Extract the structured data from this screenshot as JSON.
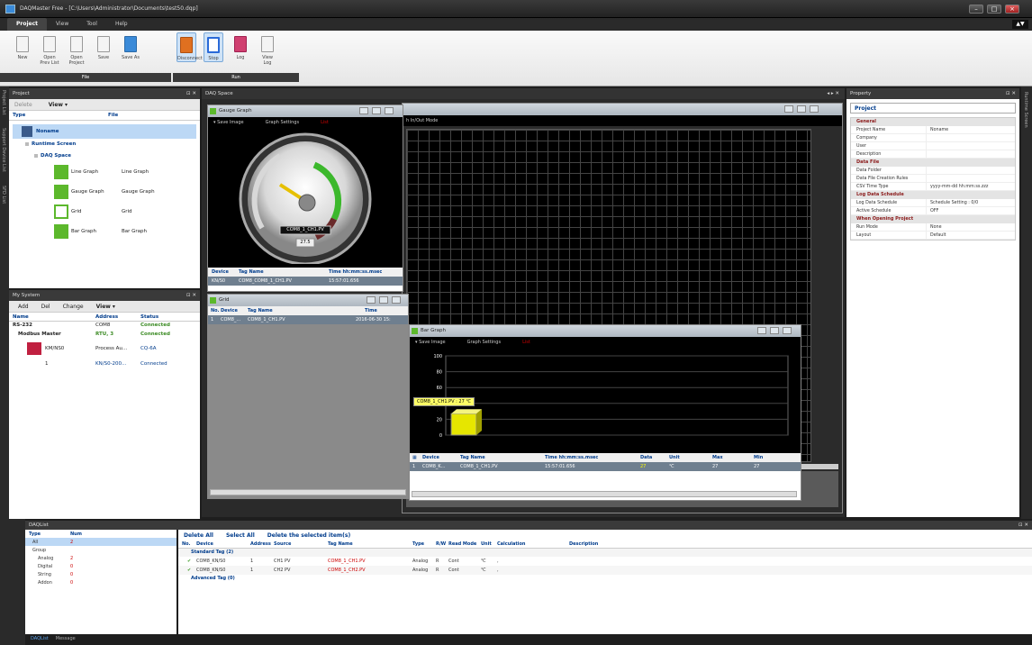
{
  "app": {
    "title": "DAQMaster Free - [C:\\Users\\Administrator\\Documents\\test50.dqp]"
  },
  "menu": [
    "Project",
    "View",
    "Tool",
    "Help"
  ],
  "ribbon": {
    "file_buttons": [
      "New",
      "Open Prev List",
      "Open Project",
      "Save",
      "Save As"
    ],
    "run_buttons": [
      "Disconnect",
      "Stop",
      "Log",
      "View Log"
    ],
    "file_group": "File",
    "run_group": "Run"
  },
  "project_panel": {
    "title": "Project",
    "toolbar": {
      "delete": "Delete",
      "view": "View ▾"
    },
    "columns": [
      "Type",
      "File"
    ],
    "root": "Noname",
    "runtime": "Runtime Screen",
    "daq_space": "DAQ Space",
    "items": [
      {
        "type": "Line Graph",
        "file": "Line Graph"
      },
      {
        "type": "Gauge Graph",
        "file": "Gauge Graph"
      },
      {
        "type": "Grid",
        "file": "Grid"
      },
      {
        "type": "Bar Graph",
        "file": "Bar Graph"
      }
    ]
  },
  "left_tabs": [
    "Project List",
    "Support Device List",
    "SFD List"
  ],
  "right_tabs": [
    "Runtime Screen"
  ],
  "mysystem": {
    "title": "My System",
    "toolbar": {
      "add": "Add",
      "del": "Del",
      "change": "Change",
      "view": "View ▾"
    },
    "columns": [
      "Name",
      "Address",
      "Status"
    ],
    "rows": [
      {
        "name": "RS-232",
        "address": "COM8",
        "status": "Connected"
      },
      {
        "name": "Modbus Master",
        "address": "RTU, 3",
        "status": "Connected"
      },
      {
        "name": "KM/NS0",
        "address": "Process Au...",
        "status": "CQ-6A"
      },
      {
        "name": "1",
        "address": "KN/S0-200...",
        "status": "Connected"
      }
    ]
  },
  "daq_space": {
    "title": "DAQ Space",
    "line_mode_label": "h In/Out Mode"
  },
  "gauge_window": {
    "title": "Gauge Graph",
    "toolbar": {
      "save": "▾ Save Image",
      "settings": "Graph Settings",
      "list": "List"
    },
    "tag_label": "COM8_1_CH1.PV",
    "value": "27.5",
    "columns": [
      "Device",
      "Tag Name",
      "Time hh:mm:ss.msec"
    ],
    "row": [
      "KN/S0",
      "COM8_COM8_1_CH1.PV",
      "15:57:01.656"
    ]
  },
  "grid_window": {
    "title": "Grid",
    "columns": [
      "No.",
      "Device",
      "Tag Name",
      "Time"
    ],
    "row": [
      "1",
      "COM8_...",
      "COM8_1_CH1.PV",
      "2016-06-30 15:"
    ]
  },
  "bar_window": {
    "title": "Bar Graph",
    "toolbar": {
      "save": "▾ Save Image",
      "settings": "Graph Settings",
      "list": "List"
    },
    "tooltip": "COM8_1_CH1.PV : 27 ℃",
    "columns": [
      "",
      "Device",
      "Tag Name",
      "Time hh:mm:ss.msec",
      "Data",
      "Unit",
      "Max",
      "Min"
    ],
    "row": [
      "1",
      "COM8_K...",
      "COM8_1_CH1.PV",
      "15:57:01.656",
      "27",
      "℃",
      "27",
      "27"
    ]
  },
  "chart_data": {
    "type": "bar",
    "categories": [
      "COM8_1_CH1.PV"
    ],
    "values": [
      27
    ],
    "ylim": [
      0,
      100
    ],
    "yticks": [
      "100",
      "80",
      "60",
      "40",
      "20",
      "0"
    ]
  },
  "property_panel": {
    "title": "Property",
    "header": "Project",
    "categories": [
      {
        "name": "General",
        "rows": [
          [
            "Project Name",
            "Noname"
          ],
          [
            "Company",
            ""
          ],
          [
            "User",
            ""
          ],
          [
            "Description",
            ""
          ]
        ]
      },
      {
        "name": "Data File",
        "rows": [
          [
            "Data Folder",
            ""
          ],
          [
            "Data File Creation Rules",
            ""
          ],
          [
            "CSV Time Type",
            "yyyy-mm-dd hh:mm:ss.zzz"
          ]
        ]
      },
      {
        "name": "Log Data Schedule",
        "rows": [
          [
            "Log Data Schedule",
            "Schedule Setting : 0/0"
          ],
          [
            "Active Schedule",
            "OFF"
          ]
        ]
      },
      {
        "name": "When Opening Project",
        "rows": [
          [
            "Run Mode",
            "None"
          ],
          [
            "Layout",
            "Default"
          ]
        ]
      }
    ]
  },
  "daqlist": {
    "title": "DAQList",
    "left_columns": [
      "Type",
      "Num"
    ],
    "left_rows": [
      {
        "type": "All",
        "num": "2",
        "selected": true
      },
      {
        "type": "Group",
        "num": ""
      },
      {
        "type": "Analog",
        "num": "2"
      },
      {
        "type": "Digital",
        "num": "0"
      },
      {
        "type": "String",
        "num": "0"
      },
      {
        "type": "Addon",
        "num": "0"
      }
    ],
    "toolbar": [
      "Delete All",
      "Select All",
      "Delete the selected item(s)"
    ],
    "columns": [
      "No.",
      "Device",
      "Address",
      "Source",
      "Tag Name",
      "Type",
      "R/W",
      "Read Mode",
      "Unit",
      "Calculation",
      "Description"
    ],
    "group_standard": "Standard Tag (2)",
    "rows": [
      [
        "",
        "COM8_KN/S0",
        "1",
        "CH1 PV",
        "COM8_1_CH1.PV",
        "Analog",
        "R",
        "Cont",
        "℃",
        ",",
        ""
      ],
      [
        "",
        "COM8_KN/S0",
        "1",
        "CH2 PV",
        "COM8_1_CH2.PV",
        "Analog",
        "R",
        "Cont",
        "℃",
        ",",
        ""
      ]
    ],
    "group_advanced": "Advanced Tag (0)"
  },
  "bottom_tabs": [
    "DAQList",
    "Message"
  ]
}
